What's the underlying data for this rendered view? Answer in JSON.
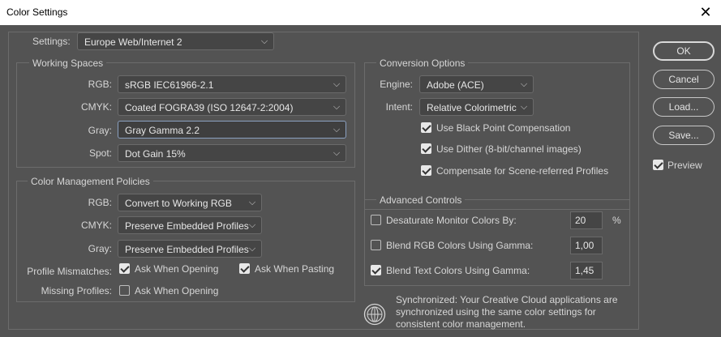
{
  "window": {
    "title": "Color Settings",
    "close_glyph": "✕"
  },
  "settings": {
    "label": "Settings:",
    "value": "Europe Web/Internet 2"
  },
  "working_spaces": {
    "title": "Working Spaces",
    "rgb": {
      "label": "RGB:",
      "value": "sRGB IEC61966-2.1"
    },
    "cmyk": {
      "label": "CMYK:",
      "value": "Coated FOGRA39 (ISO 12647-2:2004)"
    },
    "gray": {
      "label": "Gray:",
      "value": "Gray Gamma 2.2"
    },
    "spot": {
      "label": "Spot:",
      "value": "Dot Gain 15%"
    }
  },
  "policies": {
    "title": "Color Management Policies",
    "rgb": {
      "label": "RGB:",
      "value": "Convert to Working RGB"
    },
    "cmyk": {
      "label": "CMYK:",
      "value": "Preserve Embedded Profiles"
    },
    "gray": {
      "label": "Gray:",
      "value": "Preserve Embedded Profiles"
    },
    "profile_mismatches": {
      "label": "Profile Mismatches:",
      "ask_opening": "Ask When Opening",
      "ask_pasting": "Ask When Pasting"
    },
    "missing_profiles": {
      "label": "Missing Profiles:",
      "ask_opening": "Ask When Opening"
    }
  },
  "conversion": {
    "title": "Conversion Options",
    "engine": {
      "label": "Engine:",
      "value": "Adobe (ACE)"
    },
    "intent": {
      "label": "Intent:",
      "value": "Relative Colorimetric"
    },
    "black_point": "Use Black Point Compensation",
    "dither": "Use Dither (8-bit/channel images)",
    "scene_referred": "Compensate for Scene-referred Profiles"
  },
  "advanced": {
    "title": "Advanced Controls",
    "desaturate": {
      "label": "Desaturate Monitor Colors By:",
      "value": "20",
      "unit": "%"
    },
    "blend_rgb": {
      "label": "Blend RGB Colors Using Gamma:",
      "value": "1,00"
    },
    "blend_text": {
      "label": "Blend Text Colors Using Gamma:",
      "value": "1,45"
    }
  },
  "sync_message": "Synchronized: Your Creative Cloud applications are synchronized using the same color settings for consistent color management.",
  "buttons": {
    "ok": "OK",
    "cancel": "Cancel",
    "load": "Load...",
    "save": "Save...",
    "preview": "Preview"
  },
  "colors": {
    "panel": "#535353",
    "field": "#454545",
    "text": "#d6d6d6",
    "titlebar": "#ffffff"
  },
  "icons": {
    "chevron": "chevron-down-icon",
    "globe": "globe-icon",
    "close": "close-icon"
  }
}
